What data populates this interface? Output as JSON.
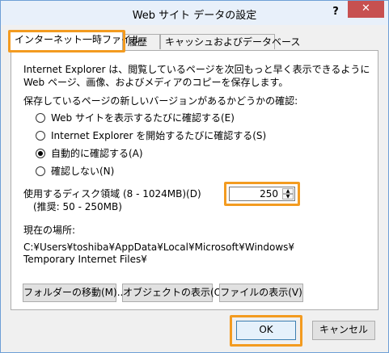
{
  "window": {
    "title": "Web サイト データの設定",
    "help": "?",
    "close": "✕"
  },
  "tabs": [
    {
      "label": "インターネット一時ファイル",
      "active": true
    },
    {
      "label": "履歴",
      "active": false
    },
    {
      "label": "キャッシュおよびデータベース",
      "active": false
    }
  ],
  "panel": {
    "desc_line1": "Internet Explorer は、閲覧しているページを次回もっと早く表示できるように",
    "desc_line2": "Web ページ、画像、およびメディアのコピーを保存します。",
    "check_heading": "保存しているページの新しいバージョンがあるかどうかの確認:",
    "options": [
      {
        "label": "Web サイトを表示するたびに確認する(E)",
        "checked": false
      },
      {
        "label": "Internet Explorer を開始するたびに確認する(S)",
        "checked": false
      },
      {
        "label": "自動的に確認する(A)",
        "checked": true
      },
      {
        "label": "確認しない(N)",
        "checked": false
      }
    ],
    "disk_label": "使用するディスク領域 (8 - 1024MB)(D)",
    "disk_recommended": "(推奨: 50 - 250MB)",
    "disk_value": "250",
    "location_label": "現在の場所:",
    "location_line1": "C:¥Users¥toshiba¥AppData¥Local¥Microsoft¥Windows¥",
    "location_line2": "Temporary Internet Files¥",
    "move_folder": "フォルダーの移動(M)...",
    "view_objects": "オブジェクトの表示(O)",
    "view_files": "ファイルの表示(V)"
  },
  "footer": {
    "ok": "OK",
    "cancel": "キャンセル"
  },
  "colors": {
    "highlight": "#f39b20",
    "close_bg": "#c75050",
    "border": "#6e9fd6"
  }
}
